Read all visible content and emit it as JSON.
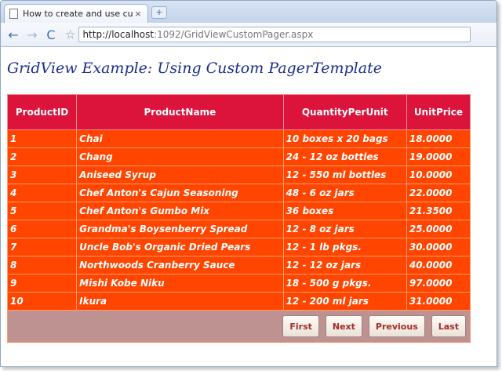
{
  "browser": {
    "tab_title": "How to create and use cus...",
    "tab_close": "×",
    "new_tab": "+",
    "back_icon": "←",
    "forward_icon": "→",
    "reload_icon": "C",
    "star_icon": "☆",
    "url_host": "http://localhost",
    "url_rest": ":1092/GridViewCustomPager.aspx"
  },
  "page": {
    "heading": "GridView Example: Using Custom PagerTemplate"
  },
  "grid": {
    "headers": [
      "ProductID",
      "ProductName",
      "QuantityPerUnit",
      "UnitPrice"
    ],
    "rows": [
      [
        "1",
        "Chai",
        "10 boxes x 20 bags",
        "18.0000"
      ],
      [
        "2",
        "Chang",
        "24 - 12 oz bottles",
        "19.0000"
      ],
      [
        "3",
        "Aniseed Syrup",
        "12 - 550 ml bottles",
        "10.0000"
      ],
      [
        "4",
        "Chef Anton's Cajun Seasoning",
        "48 - 6 oz jars",
        "22.0000"
      ],
      [
        "5",
        "Chef Anton's Gumbo Mix",
        "36 boxes",
        "21.3500"
      ],
      [
        "6",
        "Grandma's Boysenberry Spread",
        "12 - 8 oz jars",
        "25.0000"
      ],
      [
        "7",
        "Uncle Bob's Organic Dried Pears",
        "12 - 1 lb pkgs.",
        "30.0000"
      ],
      [
        "8",
        "Northwoods Cranberry Sauce",
        "12 - 12 oz jars",
        "40.0000"
      ],
      [
        "9",
        "Mishi Kobe Niku",
        "18 - 500 g pkgs.",
        "97.0000"
      ],
      [
        "10",
        "Ikura",
        "12 - 200 ml jars",
        "31.0000"
      ]
    ],
    "pager": {
      "first": "First",
      "next": "Next",
      "previous": "Previous",
      "last": "Last"
    }
  },
  "colors": {
    "header_bg": "#dc143c",
    "row_bg": "#ff4500",
    "pager_bg": "#bf9292",
    "heading_color": "#1c2d8e"
  }
}
